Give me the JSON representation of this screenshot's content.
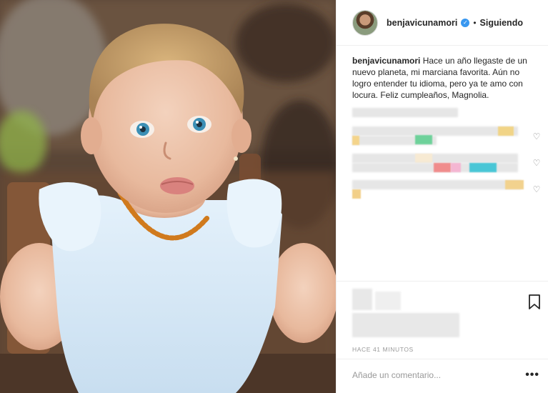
{
  "post": {
    "username": "benjavicunamori",
    "follow_status": "Siguiendo",
    "separator": "•",
    "verified_icon": "check-badge-icon",
    "caption_text": "Hace un año llegaste de un nuevo planeta, mi marciana favorita. Aún no logro entender tu idioma, pero ya te amo con locura. Feliz cumpleaños, Magnolia.",
    "timestamp": "HACE 41 MINUTOS",
    "comment_placeholder": "Añade un comentario...",
    "more_label": "•••"
  },
  "icons": {
    "like": "heart-icon",
    "save": "bookmark-icon",
    "options": "more-options-icon"
  },
  "colors": {
    "verified": "#3897f0",
    "text": "#262626",
    "muted": "#999999",
    "border": "#efefef"
  }
}
